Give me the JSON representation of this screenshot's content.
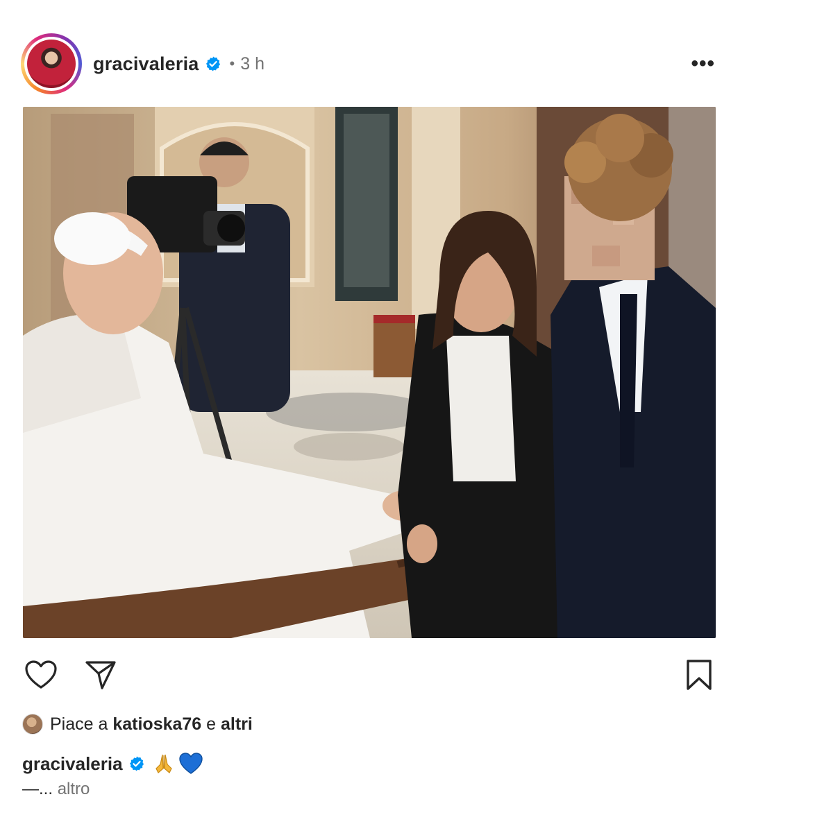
{
  "post": {
    "username": "gracivaleria",
    "verified": true,
    "separator": "•",
    "time": "3 h",
    "more_label": "•••",
    "photo": {
      "description_icon": "photo-image"
    }
  },
  "actions": {
    "like_icon": "heart-icon",
    "share_icon": "send-icon",
    "save_icon": "bookmark-icon"
  },
  "likes": {
    "prefix": "Piace a",
    "user": "katioska76",
    "joiner": "e",
    "others": "altri"
  },
  "caption": {
    "username": "gracivaleria",
    "emojis": [
      "🙏",
      "💙"
    ]
  },
  "more": {
    "dash": "—...",
    "label": "altro"
  },
  "colors": {
    "verified": "#0095f6",
    "text": "#262626",
    "muted": "#737373",
    "heart_blue": "#1d6fd6"
  }
}
